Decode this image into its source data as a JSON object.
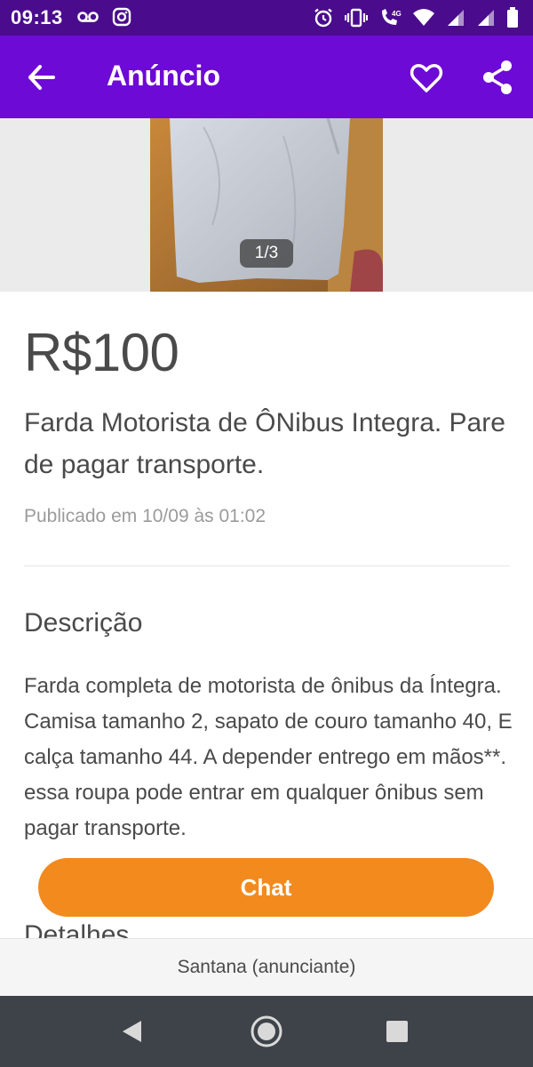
{
  "status_bar": {
    "time": "09:13",
    "network_badge": "4G"
  },
  "app_bar": {
    "title": "Anúncio",
    "back_icon": "arrow-back-icon",
    "favorite_icon": "heart-outline-icon",
    "share_icon": "share-icon"
  },
  "gallery": {
    "counter": "1/3"
  },
  "listing": {
    "price": "R$100",
    "title": "Farda Motorista de ÔNibus Integra. Pare de pagar transporte.",
    "published": "Publicado em 10/09 às 01:02"
  },
  "description": {
    "heading": "Descrição",
    "text": "Farda completa de motorista de ônibus da Íntegra. Camisa tamanho 2, sapato de couro tamanho 40, E calça tamanho 44. A depender entrego em mãos**. essa roupa pode entrar em qualquer ônibus sem pagar transporte."
  },
  "details": {
    "heading": "Detalhes"
  },
  "chat_button": {
    "label": "Chat"
  },
  "seller": {
    "label": "Santana (anunciante)"
  },
  "colors": {
    "status_bar": "#4a0c8c",
    "app_bar": "#6d0ad6",
    "chat_button": "#f28a1e",
    "nav_bar": "#3e4349"
  }
}
